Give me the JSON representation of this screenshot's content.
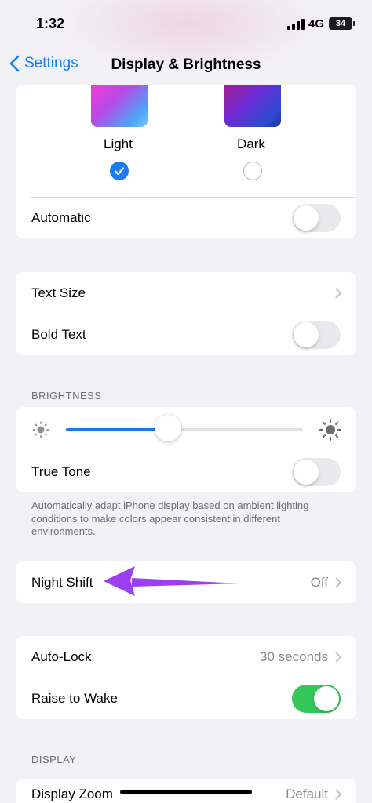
{
  "status_bar": {
    "time": "1:32",
    "network": "4G",
    "battery": "34"
  },
  "nav": {
    "back_label": "Settings",
    "title": "Display & Brightness"
  },
  "appearance": {
    "light_label": "Light",
    "dark_label": "Dark",
    "selected": "Light",
    "automatic_label": "Automatic",
    "automatic_on": false
  },
  "text": {
    "text_size_label": "Text Size",
    "bold_text_label": "Bold Text",
    "bold_text_on": false
  },
  "brightness": {
    "header": "BRIGHTNESS",
    "level": 0.43,
    "true_tone_label": "True Tone",
    "true_tone_on": false,
    "footnote": "Automatically adapt iPhone display based on ambient lighting conditions to make colors appear consistent in different environments."
  },
  "night_shift": {
    "label": "Night Shift",
    "value": "Off"
  },
  "lock": {
    "auto_lock_label": "Auto-Lock",
    "auto_lock_value": "30 seconds",
    "raise_to_wake_label": "Raise to Wake",
    "raise_to_wake_on": true
  },
  "display": {
    "header": "DISPLAY",
    "zoom_label": "Display Zoom",
    "zoom_value": "Default"
  },
  "colors": {
    "accent": "#1a7cf5",
    "toggle_on": "#34c759",
    "annotation_arrow": "#9b3ff0",
    "background": "#f2f1f6"
  }
}
